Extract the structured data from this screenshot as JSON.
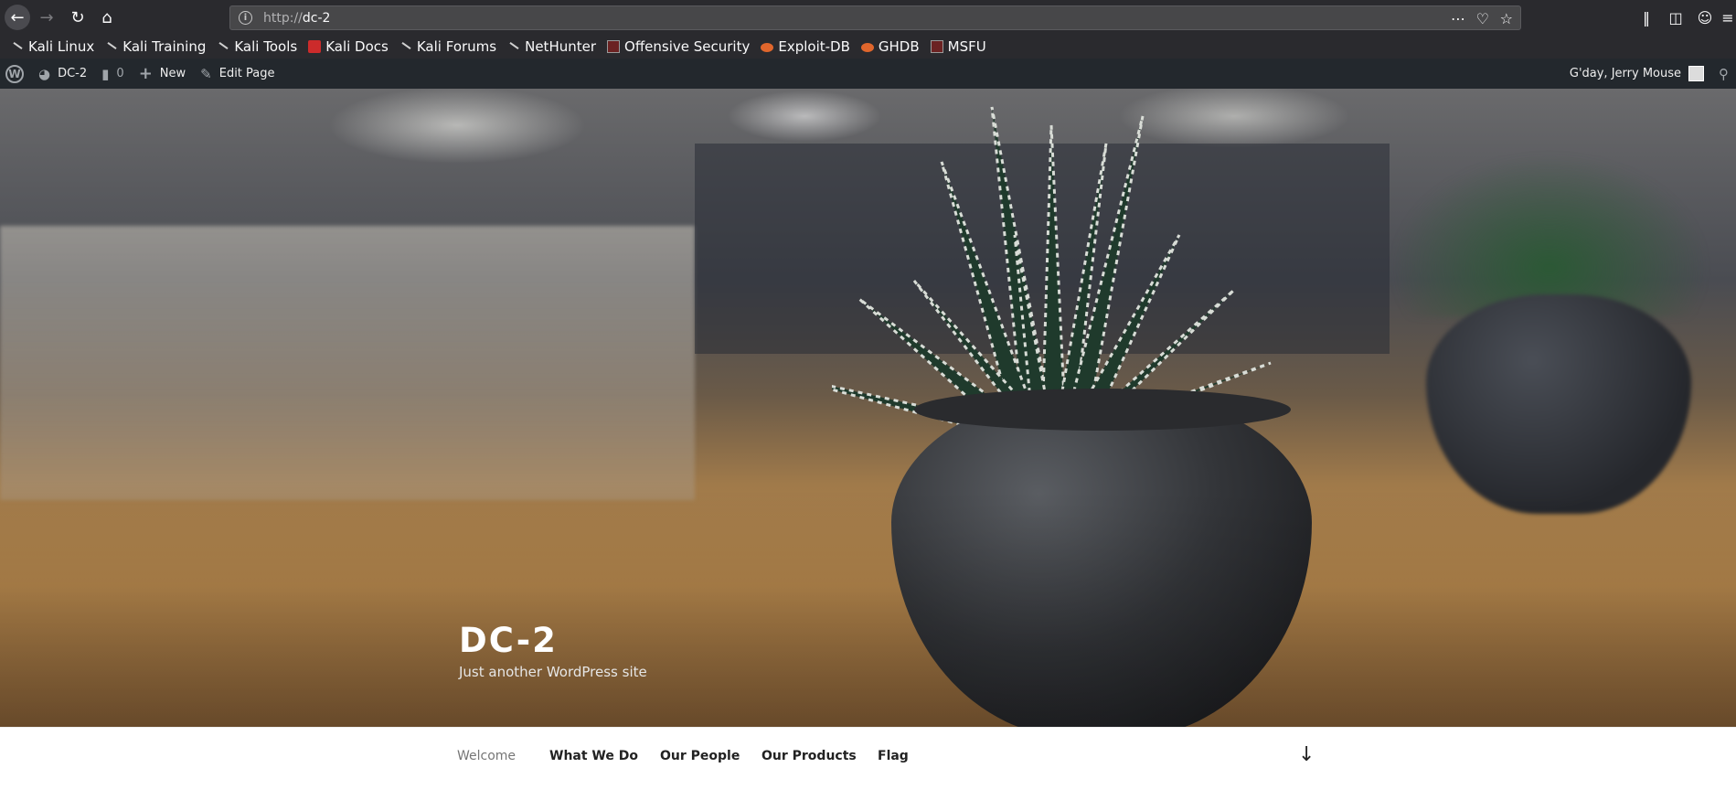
{
  "browser": {
    "url_scheme": "http://",
    "url_host": "dc-2",
    "bookmarks": [
      {
        "label": "Kali Linux",
        "icon": "kali-dragon-icon"
      },
      {
        "label": "Kali Training",
        "icon": "kali-dragon-icon"
      },
      {
        "label": "Kali Tools",
        "icon": "kali-dragon-icon"
      },
      {
        "label": "Kali Docs",
        "icon": "kali-docs-icon"
      },
      {
        "label": "Kali Forums",
        "icon": "kali-dragon-icon"
      },
      {
        "label": "NetHunter",
        "icon": "nethunter-icon"
      },
      {
        "label": "Offensive Security",
        "icon": "offsec-icon"
      },
      {
        "label": "Exploit-DB",
        "icon": "exploit-db-icon"
      },
      {
        "label": "GHDB",
        "icon": "exploit-db-icon"
      },
      {
        "label": "MSFU",
        "icon": "offsec-icon"
      }
    ]
  },
  "admin_bar": {
    "site_name": "DC-2",
    "comments_count": "0",
    "new_label": "New",
    "edit_label": "Edit Page",
    "greeting": "G'day, Jerry Mouse"
  },
  "site": {
    "title": "DC-2",
    "tagline": "Just another WordPress site"
  },
  "nav": {
    "items": [
      "Welcome",
      "What We Do",
      "Our People",
      "Our Products",
      "Flag"
    ],
    "current": "Welcome"
  },
  "colors": {
    "browser_chrome": "#2a2a2e",
    "admin_bar": "#23282d",
    "nav_current": "#767676"
  }
}
